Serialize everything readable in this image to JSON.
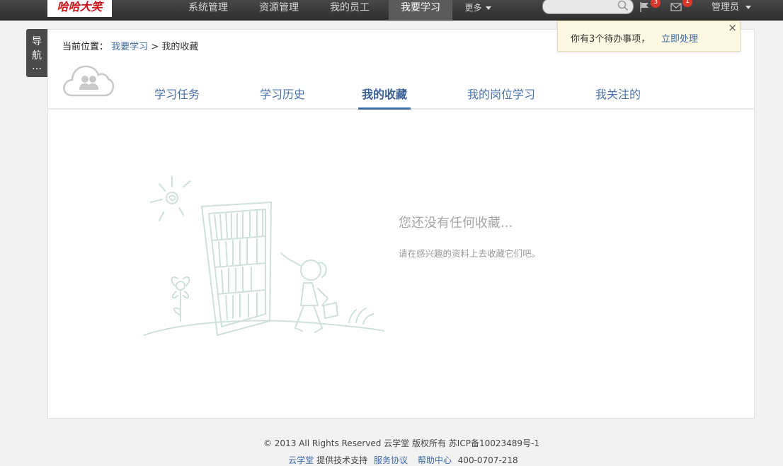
{
  "header": {
    "logo_text": "哈哈大笑",
    "nav": [
      "系统管理",
      "资源管理",
      "我的员工",
      "我要学习"
    ],
    "more": "更多",
    "search_placeholder": "",
    "flag_badge": "3",
    "mail_badge": "1",
    "user": "管理员"
  },
  "side_nav": {
    "label_line1": "导",
    "label_line2": "航",
    "label_line3": "…"
  },
  "breadcrumb": {
    "label": "当前位置：",
    "parent": "我要学习",
    "sep": ">",
    "current": "我的收藏"
  },
  "tabs": [
    {
      "label": "学习任务"
    },
    {
      "label": "学习历史"
    },
    {
      "label": "我的收藏",
      "active": true
    },
    {
      "label": "我的岗位学习"
    },
    {
      "label": "我关注的"
    }
  ],
  "empty": {
    "title": "您还没有任何收藏...",
    "subtitle": "请在感兴趣的资料上去收藏它们吧。"
  },
  "notice": {
    "text": "你有3个待办事项，",
    "link": "立即处理",
    "close": "×"
  },
  "footer": {
    "line1": "© 2013 All Rights Reserved  云学堂 版权所有  苏ICP备10023489号-1",
    "provider": "云学堂",
    "provider_suffix": "提供技术支持",
    "service": "服务协议",
    "help": "帮助中心",
    "phone": "400-0707-218"
  },
  "colors": {
    "accent": "#3e6aa3",
    "topbar": "#3a3a3a",
    "notice_bg": "#fdf8e1"
  }
}
